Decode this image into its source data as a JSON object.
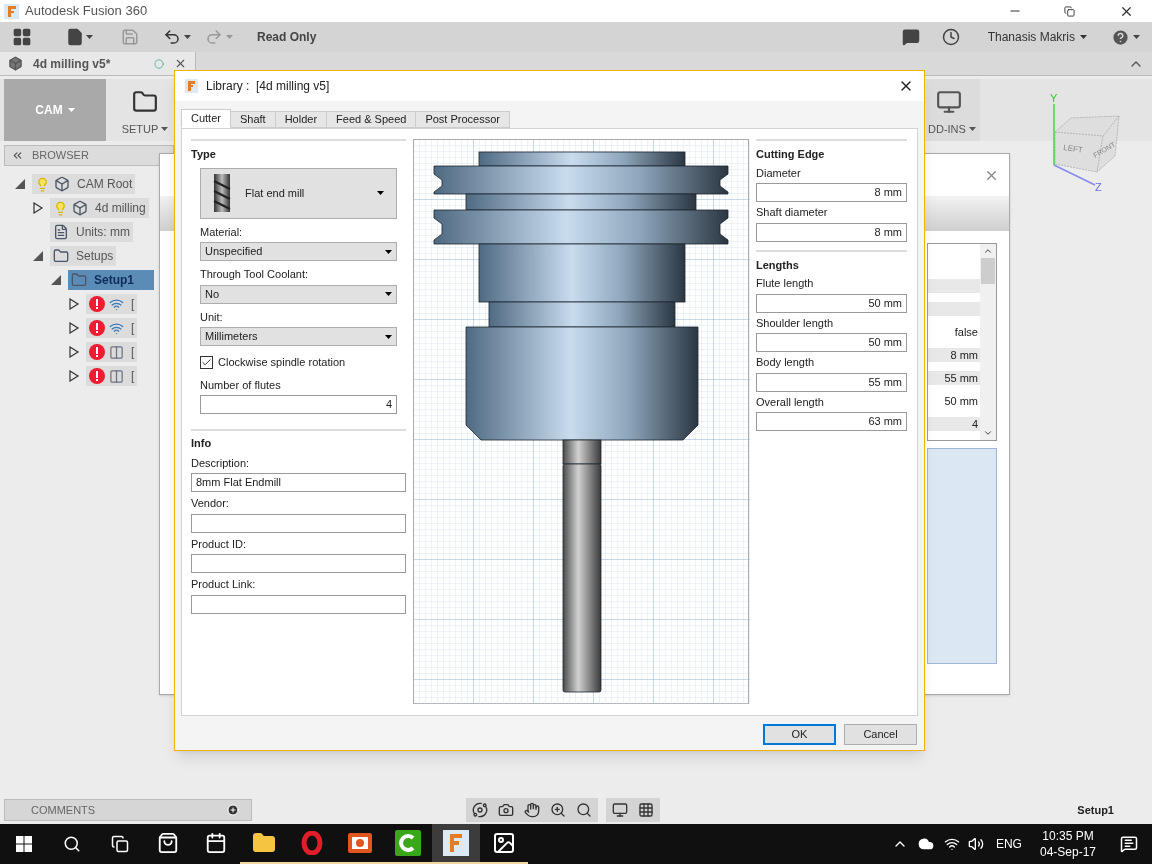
{
  "app": {
    "title": "Autodesk Fusion 360"
  },
  "toolbar": {
    "status": "Read Only",
    "user": "Thanasis Makris",
    "undo": {
      "disabled": false
    },
    "redo": {
      "disabled": true
    }
  },
  "document_tab": {
    "label": "4d milling v5*"
  },
  "ribbon": {
    "workspace": "CAM",
    "groups": [
      {
        "kind": "setup",
        "label": "SETUP"
      },
      {
        "kind": "addins",
        "label": "DD-INS"
      }
    ]
  },
  "browser": {
    "title": "BROWSER",
    "tree": [
      {
        "label": "CAM Root",
        "kind": "root",
        "visible": true,
        "expanded": true,
        "selected": false,
        "children": [
          {
            "label": "4d milling",
            "kind": "body",
            "visible": true,
            "expanded": false,
            "selected": false
          },
          {
            "label": "Units: mm",
            "kind": "units",
            "selected": false
          },
          {
            "label": "Setups",
            "kind": "folder",
            "expanded": true,
            "selected": false,
            "children": [
              {
                "label": "Setup1",
                "kind": "folder",
                "expanded": true,
                "selected": true,
                "children": [
                  {
                    "label": "[",
                    "kind": "wave",
                    "expanded": false,
                    "error": true,
                    "selected": false
                  },
                  {
                    "label": "[",
                    "kind": "wave",
                    "expanded": false,
                    "error": true,
                    "selected": false
                  },
                  {
                    "label": "[",
                    "kind": "tool",
                    "expanded": false,
                    "error": true,
                    "selected": false
                  },
                  {
                    "label": "[",
                    "kind": "tool",
                    "expanded": false,
                    "error": true,
                    "selected": false
                  }
                ]
              }
            ]
          }
        ]
      }
    ]
  },
  "viewcube": {
    "axes": [
      "Y",
      "Z"
    ],
    "faces": [
      "LEFT",
      "FRONT"
    ]
  },
  "background_dialog": {
    "rows": [
      {
        "shaded": true
      },
      {
        "shaded": true
      },
      {
        "value": "false",
        "shaded": false
      },
      {
        "value": "8 mm",
        "shaded": true
      },
      {
        "value": "55 mm",
        "shaded": true
      },
      {
        "value": "50 mm",
        "shaded": false
      },
      {
        "value": "4",
        "shaded": true
      }
    ]
  },
  "dialog": {
    "title": "Library :  [4d milling v5]",
    "tabs": [
      {
        "label": "Cutter",
        "selected": true
      },
      {
        "label": "Shaft",
        "selected": false
      },
      {
        "label": "Holder",
        "selected": false
      },
      {
        "label": "Feed & Speed",
        "selected": false
      },
      {
        "label": "Post Processor",
        "selected": false
      }
    ],
    "type": {
      "heading": "Type",
      "tool": "Flat end mill"
    },
    "cutter_fields": [
      {
        "kind": "select",
        "label": "Material:",
        "value": "Unspecified"
      },
      {
        "kind": "select",
        "label": "Through Tool Coolant:",
        "value": "No"
      },
      {
        "kind": "select",
        "label": "Unit:",
        "value": "Millimeters"
      },
      {
        "kind": "checkbox",
        "label": "Clockwise spindle rotation",
        "checked": true
      },
      {
        "kind": "number",
        "label": "Number of flutes",
        "value": "4"
      }
    ],
    "info": {
      "heading": "Info",
      "fields": [
        {
          "label": "Description:",
          "value": "8mm Flat Endmill"
        },
        {
          "label": "Vendor:"
        },
        {
          "label": "Product ID:"
        },
        {
          "label": "Product Link:"
        }
      ]
    },
    "sections": [
      {
        "heading": "Cutting Edge",
        "fields": [
          {
            "label": "Diameter",
            "value": "8 mm"
          },
          {
            "label": "Shaft diameter",
            "value": "8 mm"
          }
        ]
      },
      {
        "heading": "Lengths",
        "fields": [
          {
            "label": "Flute length",
            "value": "50 mm"
          },
          {
            "label": "Shoulder length",
            "value": "50 mm"
          },
          {
            "label": "Body length",
            "value": "55 mm"
          },
          {
            "label": "Overall length",
            "value": "63 mm"
          }
        ]
      }
    ],
    "buttons": [
      {
        "label": "OK",
        "default": true
      },
      {
        "label": "Cancel",
        "default": false
      }
    ]
  },
  "comments": {
    "label": "COMMENTS"
  },
  "status": "Setup1",
  "taskbar": {
    "apps": [
      {
        "kind": "store",
        "running": false,
        "selected": false
      },
      {
        "kind": "calendar",
        "running": false,
        "selected": false
      },
      {
        "kind": "explorer",
        "running": true,
        "selected": false
      },
      {
        "kind": "opera",
        "running": true,
        "selected": false
      },
      {
        "kind": "presentation",
        "running": true,
        "selected": false
      },
      {
        "kind": "camtasia",
        "running": true,
        "selected": false
      },
      {
        "kind": "fusion",
        "running": true,
        "selected": true
      },
      {
        "kind": "photos",
        "running": true,
        "selected": false
      }
    ],
    "language": "ENG",
    "time": "10:35 PM",
    "date": "04-Sep-17"
  }
}
